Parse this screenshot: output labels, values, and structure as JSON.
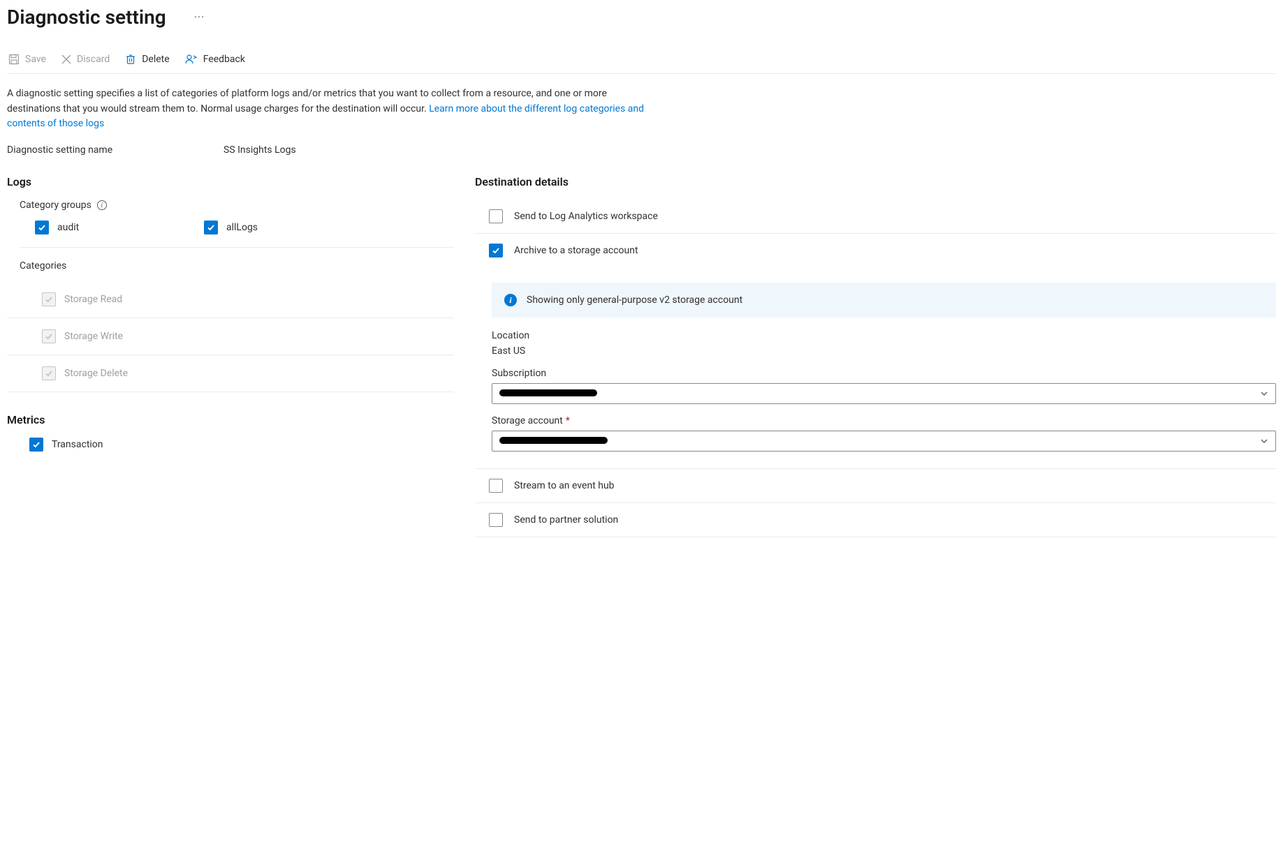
{
  "header": {
    "title": "Diagnostic setting"
  },
  "toolbar": {
    "save_label": "Save",
    "discard_label": "Discard",
    "delete_label": "Delete",
    "feedback_label": "Feedback"
  },
  "intro": {
    "text": "A diagnostic setting specifies a list of categories of platform logs and/or metrics that you want to collect from a resource, and one or more destinations that you would stream them to. Normal usage charges for the destination will occur. ",
    "link_text": "Learn more about the different log categories and contents of those logs"
  },
  "name_field": {
    "label": "Diagnostic setting name",
    "value": "SS Insights Logs"
  },
  "logs": {
    "title": "Logs",
    "category_groups_label": "Category groups",
    "group_audit": "audit",
    "group_all": "allLogs",
    "categories_label": "Categories",
    "cat_read": "Storage Read",
    "cat_write": "Storage Write",
    "cat_delete": "Storage Delete"
  },
  "metrics": {
    "title": "Metrics",
    "item_transaction": "Transaction"
  },
  "dest": {
    "title": "Destination details",
    "law_label": "Send to Log Analytics workspace",
    "storage_label": "Archive to a storage account",
    "eventhub_label": "Stream to an event hub",
    "partner_label": "Send to partner solution",
    "storage_panel": {
      "info_text": "Showing only general-purpose v2 storage account",
      "location_label": "Location",
      "location_value": "East US",
      "subscription_label": "Subscription",
      "subscription_value": "",
      "storage_account_label": "Storage account",
      "storage_account_value": ""
    }
  }
}
